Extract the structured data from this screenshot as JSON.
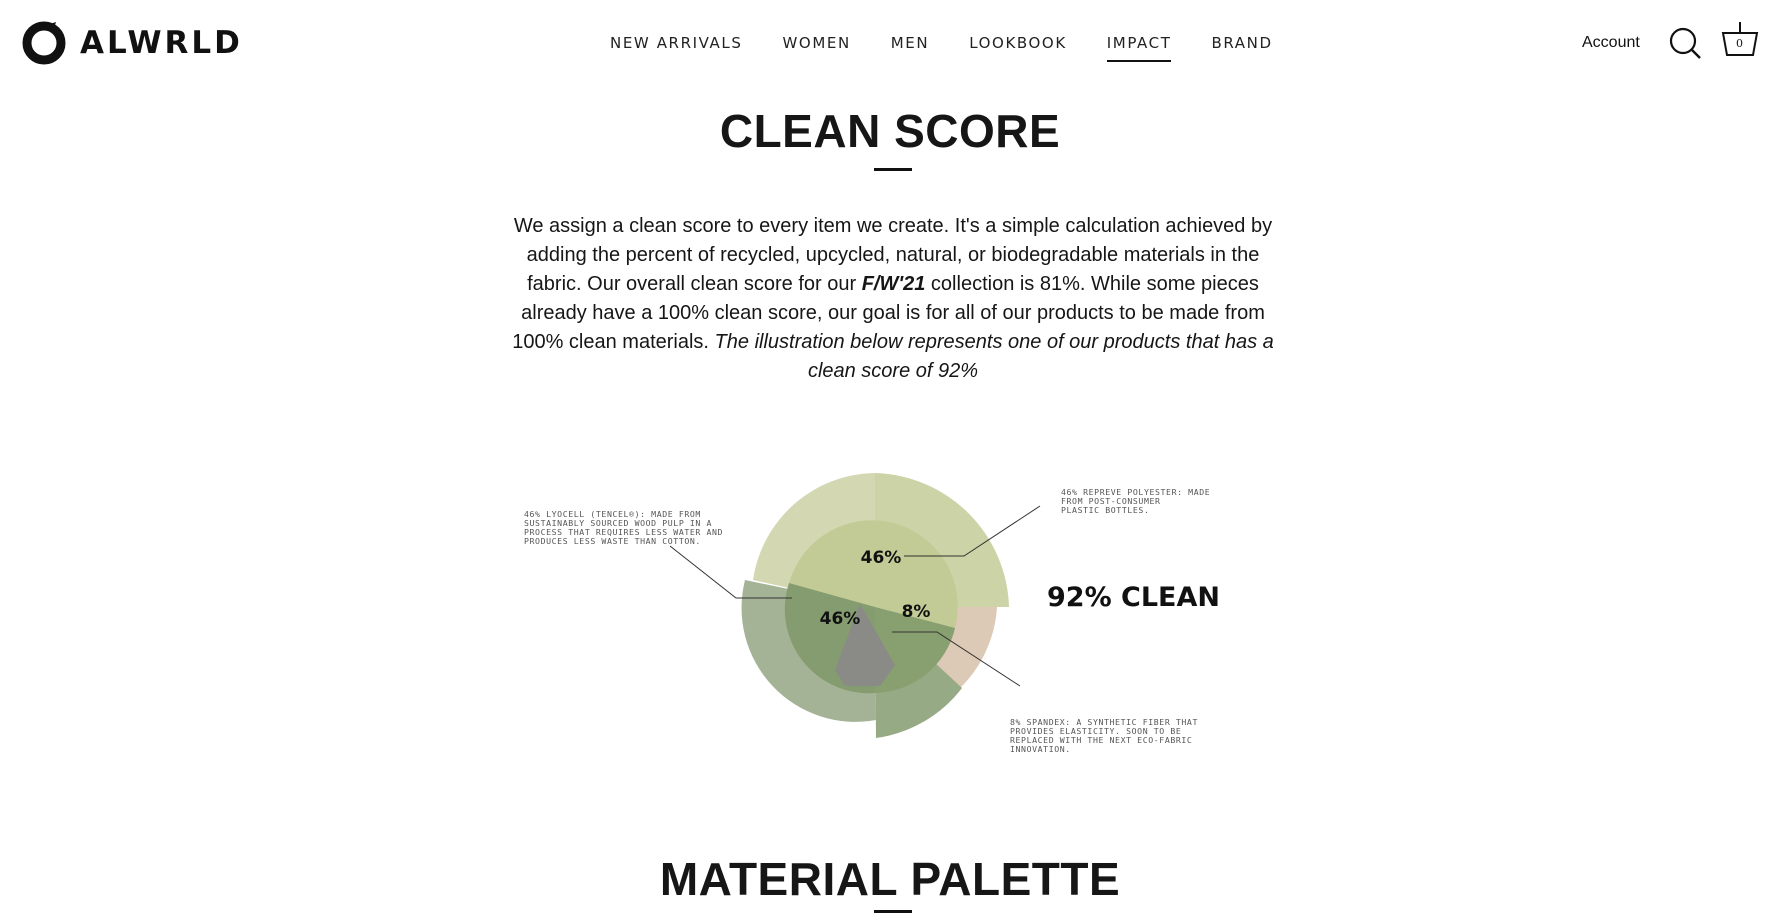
{
  "brand": {
    "name": "ALWRLD"
  },
  "nav": {
    "items": [
      {
        "label": "NEW ARRIVALS"
      },
      {
        "label": "WOMEN"
      },
      {
        "label": "MEN"
      },
      {
        "label": "LOOKBOOK"
      },
      {
        "label": "IMPACT",
        "active": true
      },
      {
        "label": "BRAND"
      }
    ]
  },
  "header": {
    "account_label": "Account",
    "search_icon": "search-icon",
    "cart_icon": "basket-icon",
    "cart_count": "0"
  },
  "clean_score": {
    "title": "CLEAN SCORE",
    "text_1": "We assign a clean score to every item we create. It's a simple calculation achieved by adding the percent of recycled, upcycled, natural, or biodegradable materials in the fabric. Our overall clean score for our ",
    "text_bold": "F/W'21",
    "text_2": " collection is 81%. While some pieces already have a 100% clean score, our goal is for all of our products to be made from 100% clean materials. ",
    "text_italic": "The illustration below represents one of our products that has a clean score of 92%"
  },
  "chart_data": {
    "type": "pie",
    "slices": [
      {
        "label": "46%",
        "value": 46,
        "description": "46% REPREVE POLYESTER: MADE FROM POST-CONSUMER PLASTIC BOTTLES.",
        "color": "#cfd4ad"
      },
      {
        "label": "46%",
        "value": 46,
        "description": "46% LYOCELL (TENCEL®): MADE FROM SUSTAINABLY SOURCED WOOD PULP IN A PROCESS THAT REQUIRES LESS WATER AND PRODUCES LESS WASTE THAN COTTON.",
        "color": "#8fa37c"
      },
      {
        "label": "8%",
        "value": 8,
        "description": "8% SPANDEX: A SYNTHETIC FIBER THAT PROVIDES ELASTICITY. SOON TO BE REPLACED WITH THE NEXT ECO-FABRIC INNOVATION.",
        "color": "#d9c7b4"
      }
    ],
    "center_label": "92% CLEAN"
  },
  "callouts": {
    "polyester": [
      "46% REPREVE POLYESTER: MADE",
      "FROM POST-CONSUMER",
      "PLASTIC BOTTLES."
    ],
    "lyocell": [
      "46% LYOCELL (TENCEL®): MADE FROM",
      "SUSTAINABLY SOURCED WOOD PULP IN A",
      "PROCESS THAT REQUIRES LESS WATER AND",
      "PRODUCES LESS WASTE THAN COTTON."
    ],
    "spandex": [
      "8% SPANDEX: A SYNTHETIC FIBER THAT",
      "PROVIDES ELASTICITY. SOON TO BE",
      "REPLACED WITH THE NEXT ECO-FABRIC",
      "INNOVATION."
    ]
  },
  "material_palette": {
    "title": "MATERIAL PALETTE"
  }
}
